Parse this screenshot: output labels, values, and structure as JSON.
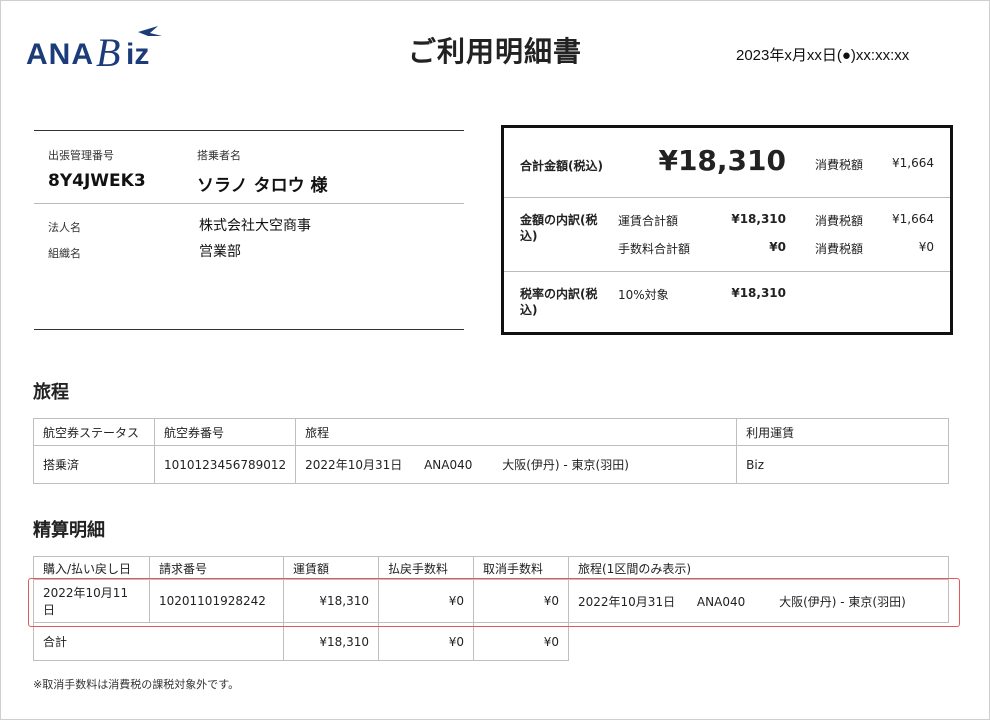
{
  "header": {
    "logo_text": "ANA Biz",
    "title": "ご利用明細書",
    "datetime": "2023年x月xx日(●)xx:xx:xx"
  },
  "traveler": {
    "trip_id_label": "出張管理番号",
    "trip_id": "8Y4JWEK3",
    "passenger_label": "搭乗者名",
    "passenger": "ソラノ タロウ 様",
    "company_label": "法人名",
    "company": "株式会社大空商事",
    "org_label": "組織名",
    "org": "営業部"
  },
  "summary": {
    "total_label": "合計金額(税込)",
    "total": "¥18,310",
    "total_tax_label": "消費税額",
    "total_tax": "¥1,664",
    "breakdown_label": "金額の内訳(税込)",
    "fare_label": "運賃合計額",
    "fare": "¥18,310",
    "fare_tax_label": "消費税額",
    "fare_tax": "¥1,664",
    "fee_label": "手数料合計額",
    "fee": "¥0",
    "fee_tax_label": "消費税額",
    "fee_tax": "¥0",
    "rate_label": "税率の内訳(税込)",
    "rate_name": "10%対象",
    "rate_amount": "¥18,310"
  },
  "itinerary": {
    "heading": "旅程",
    "headers": [
      "航空券ステータス",
      "航空券番号",
      "旅程",
      "利用運賃"
    ],
    "rows": [
      {
        "status": "搭乗済",
        "ticket": "1010123456789012",
        "date": "2022年10月31日",
        "flight": "ANA040",
        "route": "大阪(伊丹) - 東京(羽田)",
        "fare": "Biz"
      }
    ]
  },
  "settlement": {
    "heading": "精算明細",
    "headers": [
      "購入/払い戻し日",
      "請求番号",
      "運賃額",
      "払戻手数料",
      "取消手数料",
      "旅程(1区間のみ表示)"
    ],
    "rows": [
      {
        "date": "2022年10月11日",
        "invoice": "10201101928242",
        "fare": "¥18,310",
        "refund_fee": "¥0",
        "cancel_fee": "¥0",
        "trip_date": "2022年10月31日",
        "flight": "ANA040",
        "route": "大阪(伊丹) - 東京(羽田)"
      }
    ],
    "total_label": "合計",
    "total_fare": "¥18,310",
    "total_refund_fee": "¥0",
    "total_cancel_fee": "¥0"
  },
  "note": "※取消手数料は消費税の課税対象外です。",
  "colors": {
    "brand": "#1c3b7a",
    "highlight": "#e05a5a"
  }
}
